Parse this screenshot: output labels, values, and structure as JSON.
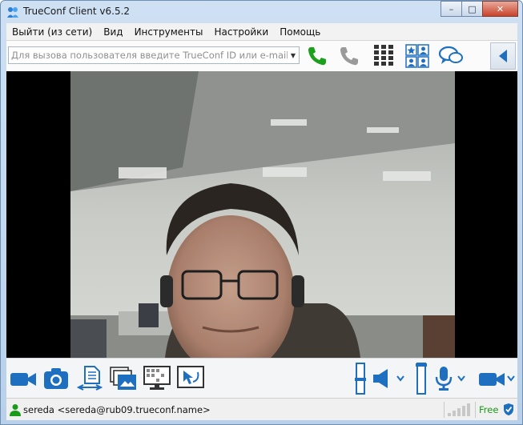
{
  "window": {
    "title": "TrueConf Client v6.5.2",
    "minimize": "–",
    "maximize": "□",
    "close": "✕"
  },
  "menu": {
    "items": [
      "Выйти (из сети)",
      "Вид",
      "Инструменты",
      "Настройки",
      "Помощь"
    ]
  },
  "toolbar": {
    "search_placeholder": "Для вызова пользователя введите TrueConf ID или e-mail",
    "search_value": "",
    "icons": [
      "call-icon",
      "hangup-icon",
      "dialpad-icon",
      "address-book-icon",
      "chat-icon",
      "collapse-panel-icon"
    ]
  },
  "controls": {
    "icons": [
      "camera-icon",
      "snapshot-icon",
      "file-transfer-icon",
      "picture-in-picture-icon",
      "screen-share-icon",
      "remote-desktop-icon",
      "speaker-volume-icon",
      "microphone-icon",
      "video-toggle-icon"
    ],
    "speaker_volume": 0.5,
    "mic_volume": 0.6
  },
  "status": {
    "user": "sereda <sereda@rub09.trueconf.name>",
    "plan": "Free",
    "signal_bars_lit": 0,
    "signal_bars_total": 5
  },
  "colors": {
    "accent": "#1e7fd0",
    "call_green": "#1aa01a",
    "status_green": "#1a9a1a"
  }
}
